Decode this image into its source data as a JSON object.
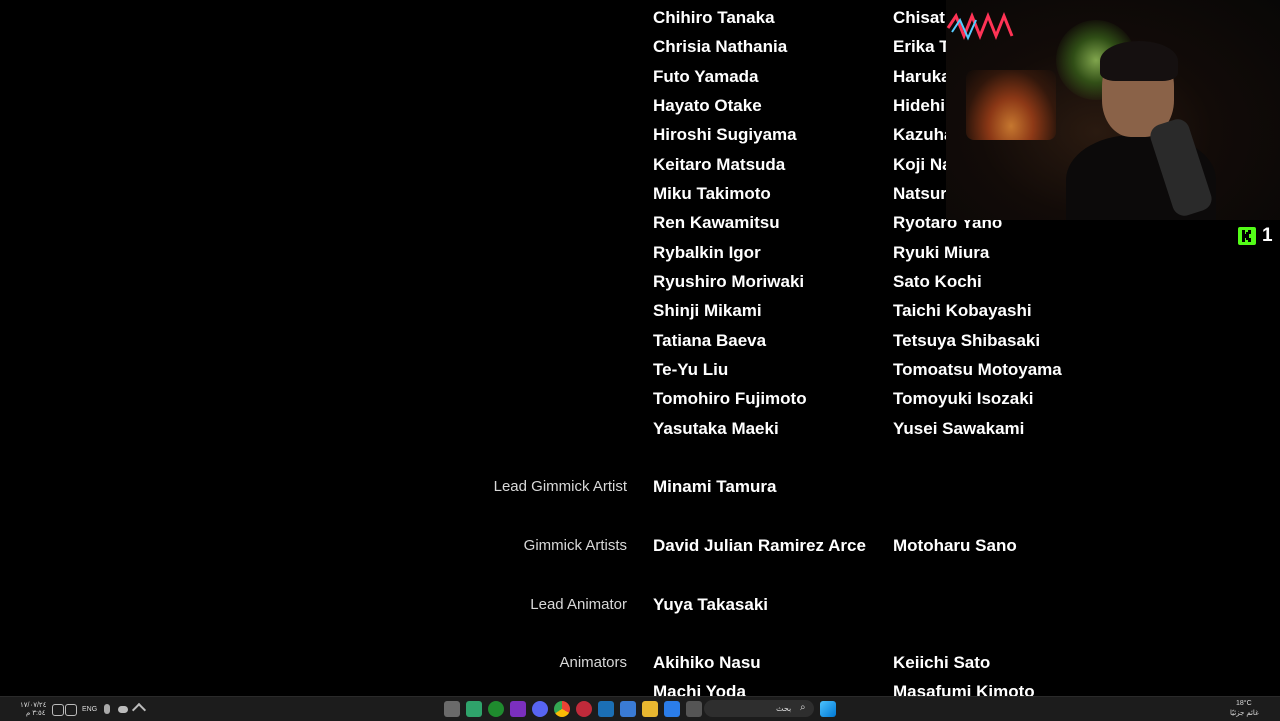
{
  "credits": {
    "grid_rows": [
      [
        "Chihiro Tanaka",
        "Chisat"
      ],
      [
        "Chrisia Nathania",
        "Erika T"
      ],
      [
        "Futo Yamada",
        "Haruka"
      ],
      [
        "Hayato Otake",
        "Hidehi"
      ],
      [
        "Hiroshi Sugiyama",
        "Kazuha"
      ],
      [
        "Keitaro Matsuda",
        "Koji Na"
      ],
      [
        "Miku Takimoto",
        "Natsur"
      ],
      [
        "Ren Kawamitsu",
        "Ryotaro Yano"
      ],
      [
        "Rybalkin Igor",
        "Ryuki Miura"
      ],
      [
        "Ryushiro Moriwaki",
        "Sato Kochi"
      ],
      [
        "Shinji Mikami",
        "Taichi Kobayashi"
      ],
      [
        "Tatiana Baeva",
        "Tetsuya Shibasaki"
      ],
      [
        "Te-Yu Liu",
        "Tomoatsu Motoyama"
      ],
      [
        "Tomohiro Fujimoto",
        "Tomoyuki Isozaki"
      ],
      [
        "Yasutaka Maeki",
        "Yusei Sawakami"
      ]
    ],
    "sections": [
      {
        "role": "Lead Gimmick Artist",
        "names": [
          "Minami Tamura"
        ]
      },
      {
        "role": "Gimmick Artists",
        "names": [
          "David Julian Ramirez Arce",
          "Motoharu Sano"
        ]
      },
      {
        "role": "Lead Animator",
        "names": [
          "Yuya Takasaki"
        ]
      },
      {
        "role": "Animators",
        "names": [
          "Akihiko Nasu",
          "Keiichi Sato",
          "Machi Yoda",
          "Masafumi Kimoto"
        ]
      }
    ]
  },
  "stream_overlay": {
    "kick_icon": "kick-logo-icon",
    "kick_color": "#53fc18",
    "viewer_count": "1"
  },
  "taskbar": {
    "background": "#1c1c1c",
    "language": "ENG",
    "search_placeholder": "بحث",
    "weather_temp": "18°C",
    "weather_text": "غائم جزئيًا",
    "time": "٣:٥٤ م",
    "date": "١٧/٠٧/٢٤"
  }
}
